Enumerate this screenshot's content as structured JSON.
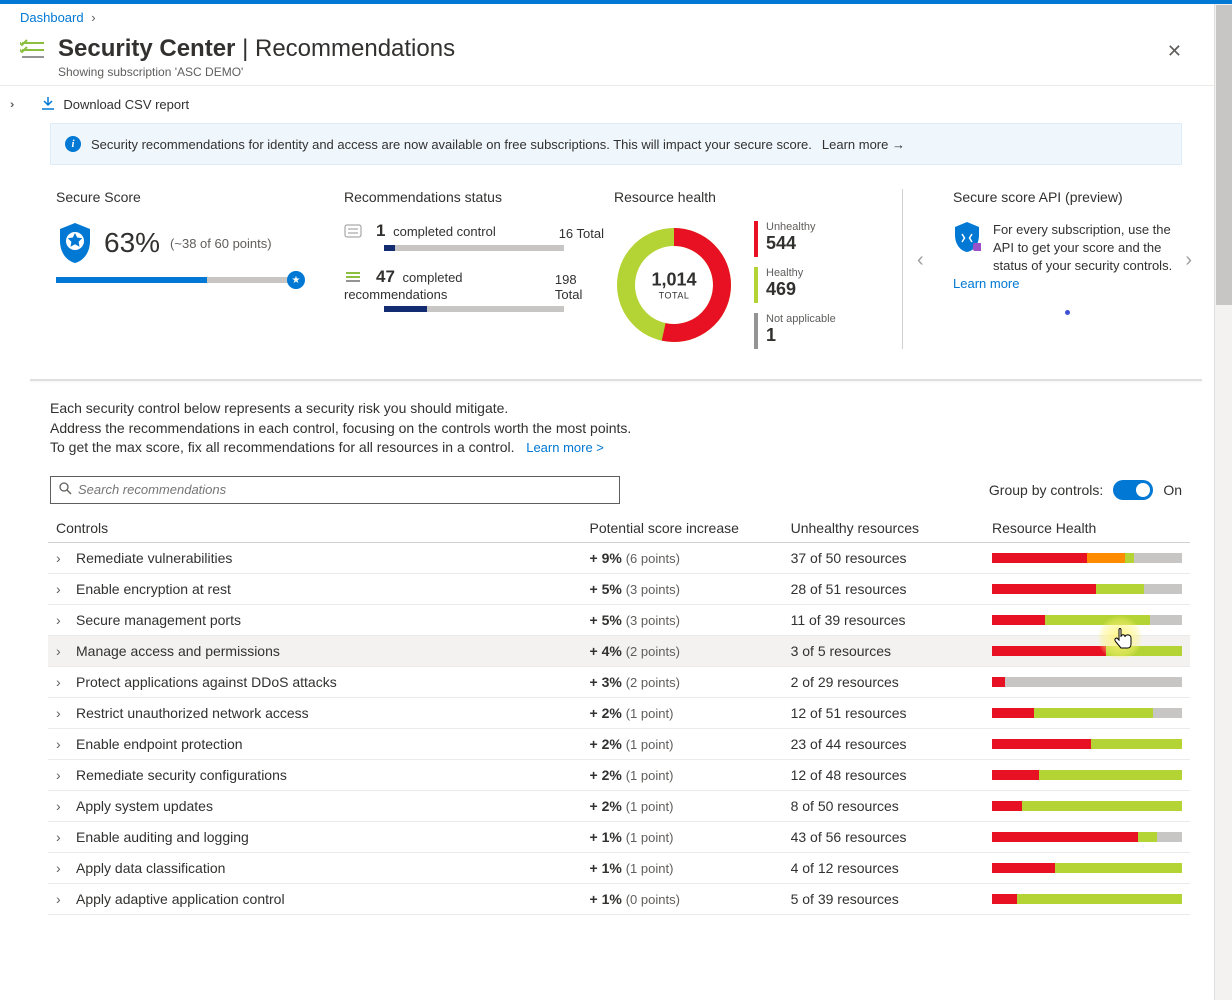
{
  "breadcrumb": {
    "dashboard": "Dashboard"
  },
  "header": {
    "title_main": "Security Center",
    "title_sub": "Recommendations",
    "subtitle": "Showing subscription 'ASC DEMO'"
  },
  "toolbar": {
    "download": "Download CSV report"
  },
  "banner": {
    "text": "Security recommendations for identity and access are now available on free subscriptions. This will impact your secure score.",
    "learn": "Learn more →"
  },
  "secure_score": {
    "title": "Secure Score",
    "pct": "63%",
    "points": "(~38 of 60 points)"
  },
  "rec_status": {
    "title": "Recommendations status",
    "controls_num": "1",
    "controls_label": "completed control",
    "controls_total": "16 Total",
    "recs_num": "47",
    "recs_label": "completed recommendations",
    "recs_total": "198 Total"
  },
  "resource_health": {
    "title": "Resource health",
    "total_num": "1,014",
    "total_label": "TOTAL",
    "unhealthy_label": "Unhealthy",
    "unhealthy_val": "544",
    "healthy_label": "Healthy",
    "healthy_val": "469",
    "na_label": "Not applicable",
    "na_val": "1"
  },
  "api": {
    "title": "Secure score API (preview)",
    "text": "For every subscription, use the API to get your score and the status of your security controls.",
    "learn": "Learn more"
  },
  "intro": {
    "l1": "Each security control below represents a security risk you should mitigate.",
    "l2": "Address the recommendations in each control, focusing on the controls worth the most points.",
    "l3": "To get the max score, fix all recommendations for all resources in a control.",
    "learn": "Learn more >"
  },
  "search": {
    "placeholder": "Search recommendations"
  },
  "group": {
    "label": "Group by controls:",
    "state": "On"
  },
  "columns": {
    "c1": "Controls",
    "c2": "Potential score increase",
    "c3": "Unhealthy resources",
    "c4": "Resource Health"
  },
  "rows": [
    {
      "name": "Remediate vulnerabilities",
      "pct": "+ 9%",
      "pts": "(6 points)",
      "unhealthy": "37 of 50 resources",
      "bar": {
        "red": 50,
        "orange": 20,
        "green": 5,
        "gray": 25
      }
    },
    {
      "name": "Enable encryption at rest",
      "pct": "+ 5%",
      "pts": "(3 points)",
      "unhealthy": "28 of 51 resources",
      "bar": {
        "red": 55,
        "orange": 0,
        "green": 25,
        "gray": 20
      }
    },
    {
      "name": "Secure management ports",
      "pct": "+ 5%",
      "pts": "(3 points)",
      "unhealthy": "11 of 39 resources",
      "bar": {
        "red": 28,
        "orange": 0,
        "green": 55,
        "gray": 17
      }
    },
    {
      "name": "Manage access and permissions",
      "pct": "+ 4%",
      "pts": "(2 points)",
      "unhealthy": "3 of 5 resources",
      "bar": {
        "red": 60,
        "orange": 0,
        "green": 40,
        "gray": 0
      },
      "highlight": true
    },
    {
      "name": "Protect applications against DDoS attacks",
      "pct": "+ 3%",
      "pts": "(2 points)",
      "unhealthy": "2 of 29 resources",
      "bar": {
        "red": 7,
        "orange": 0,
        "green": 0,
        "gray": 93
      }
    },
    {
      "name": "Restrict unauthorized network access",
      "pct": "+ 2%",
      "pts": "(1 point)",
      "unhealthy": "12 of 51 resources",
      "bar": {
        "red": 22,
        "orange": 0,
        "green": 63,
        "gray": 15
      }
    },
    {
      "name": "Enable endpoint protection",
      "pct": "+ 2%",
      "pts": "(1 point)",
      "unhealthy": "23 of 44 resources",
      "bar": {
        "red": 52,
        "orange": 0,
        "green": 48,
        "gray": 0
      }
    },
    {
      "name": "Remediate security configurations",
      "pct": "+ 2%",
      "pts": "(1 point)",
      "unhealthy": "12 of 48 resources",
      "bar": {
        "red": 25,
        "orange": 0,
        "green": 75,
        "gray": 0
      }
    },
    {
      "name": "Apply system updates",
      "pct": "+ 2%",
      "pts": "(1 point)",
      "unhealthy": "8 of 50 resources",
      "bar": {
        "red": 16,
        "orange": 0,
        "green": 84,
        "gray": 0
      }
    },
    {
      "name": "Enable auditing and logging",
      "pct": "+ 1%",
      "pts": "(1 point)",
      "unhealthy": "43 of 56 resources",
      "bar": {
        "red": 77,
        "orange": 0,
        "green": 10,
        "gray": 13
      }
    },
    {
      "name": "Apply data classification",
      "pct": "+ 1%",
      "pts": "(1 point)",
      "unhealthy": "4 of 12 resources",
      "bar": {
        "red": 33,
        "orange": 0,
        "green": 67,
        "gray": 0
      }
    },
    {
      "name": "Apply adaptive application control",
      "pct": "+ 1%",
      "pts": "(0 points)",
      "unhealthy": "5 of 39 resources",
      "bar": {
        "red": 13,
        "orange": 0,
        "green": 87,
        "gray": 0
      }
    }
  ]
}
